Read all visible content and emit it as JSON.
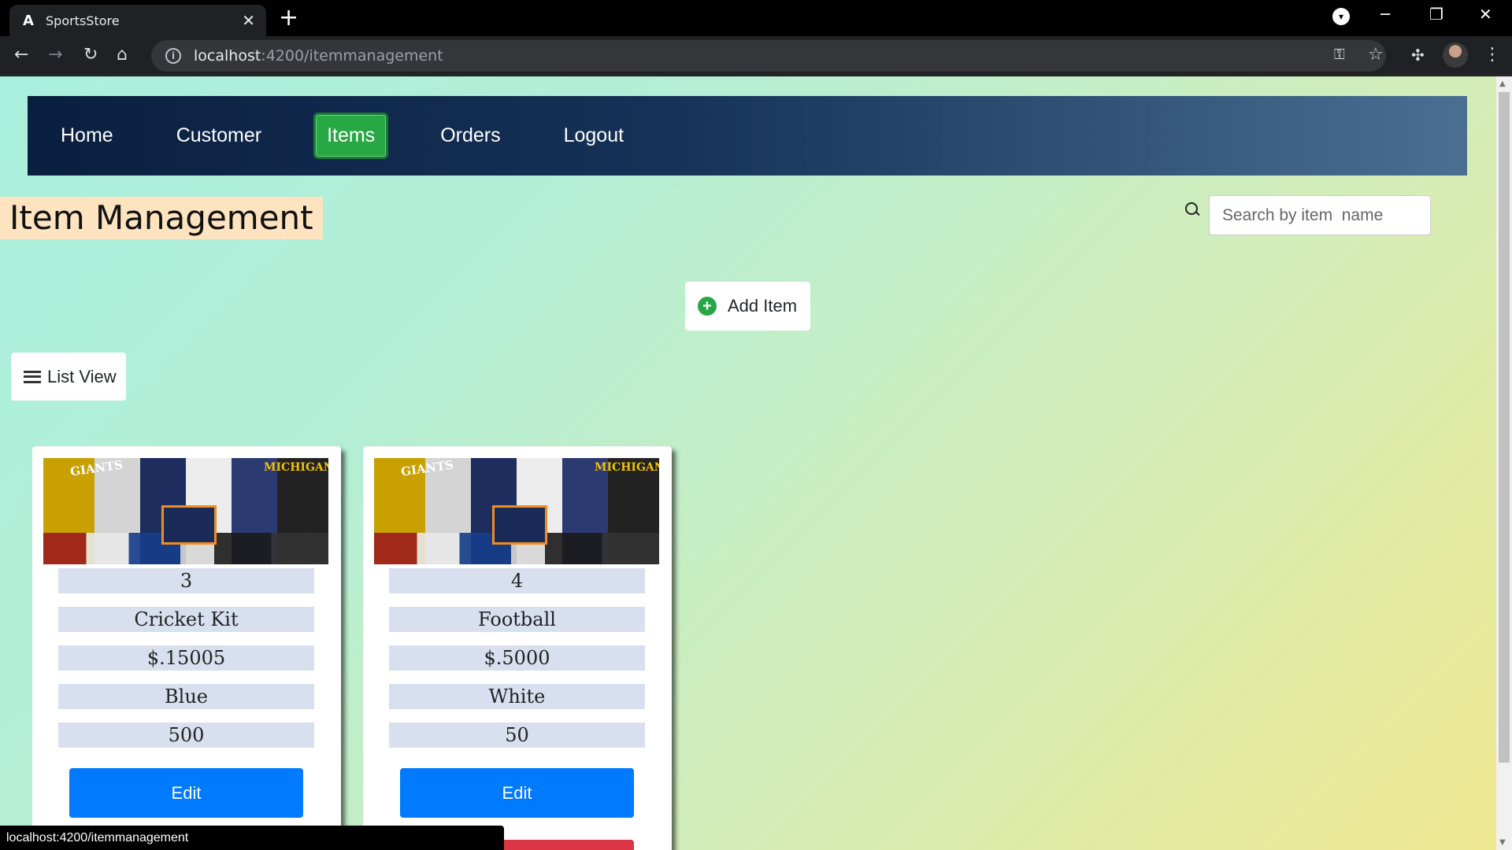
{
  "browser": {
    "tab_title": "SportsStore",
    "favicon_letter": "A",
    "tab_close": "✕",
    "new_tab": "+",
    "url_host": "localhost",
    "url_path": ":4200/itemmanagement",
    "status_url": "localhost:4200/itemmanagement"
  },
  "nav": {
    "items": [
      {
        "label": "Home"
      },
      {
        "label": "Customer"
      },
      {
        "label": "Items"
      },
      {
        "label": "Orders"
      },
      {
        "label": "Logout"
      }
    ],
    "active_index": 2
  },
  "page": {
    "title": "Item Management",
    "search_placeholder": "Search by item  name",
    "add_label": "Add Item",
    "list_view_label": "List View"
  },
  "cards": [
    {
      "id": "3",
      "name": "Cricket Kit",
      "price": "$.15005",
      "color": "Blue",
      "qty": "500",
      "edit_label": "Edit",
      "img_text_left": "GIANTS",
      "img_text_right": "MICHIGAN"
    },
    {
      "id": "4",
      "name": "Football",
      "price": "$.5000",
      "color": "White",
      "qty": "50",
      "edit_label": "Edit",
      "img_text_left": "GIANTS",
      "img_text_right": "MICHIGAN"
    }
  ],
  "colors": {
    "active_nav": "#28a745",
    "edit_button": "#007bff",
    "delete_button": "#dc3545",
    "title_highlight": "#fde3c0"
  },
  "icons": [
    "back-icon",
    "forward-icon",
    "reload-icon",
    "home-icon",
    "info-icon",
    "key-icon",
    "star-icon",
    "extensions-icon",
    "menu-icon",
    "search-icon",
    "plus-circle-icon",
    "list-icon"
  ]
}
